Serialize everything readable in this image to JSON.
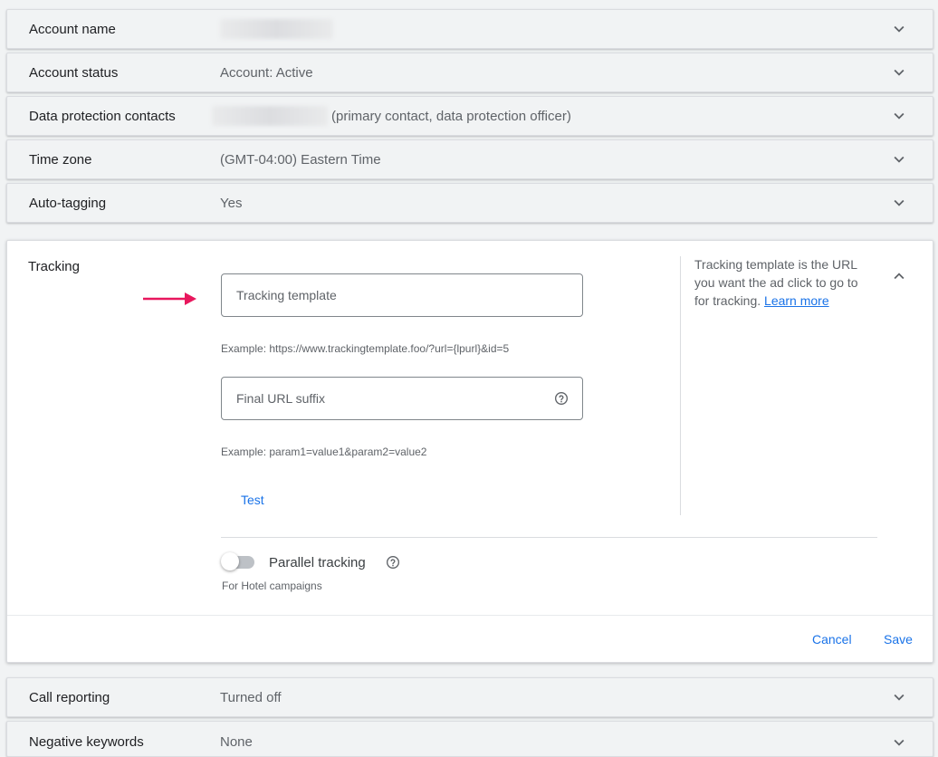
{
  "rows_top": [
    {
      "label": "Account name",
      "value": ""
    },
    {
      "label": "Account status",
      "value": "Account: Active"
    },
    {
      "label": "Data protection contacts",
      "value": "(primary contact, data protection officer)"
    },
    {
      "label": "Time zone",
      "value": "(GMT-04:00) Eastern Time"
    },
    {
      "label": "Auto-tagging",
      "value": "Yes"
    }
  ],
  "tracking": {
    "title": "Tracking",
    "template_placeholder": "Tracking template",
    "template_example": "Example: https://www.trackingtemplate.foo/?url={lpurl}&id=5",
    "suffix_placeholder": "Final URL suffix",
    "suffix_example": "Example: param1=value1&param2=value2",
    "test_label": "Test",
    "help_text": "Tracking template is the URL you want the ad click to go to for tracking.",
    "learn_more": "Learn more",
    "parallel_label": "Parallel tracking",
    "parallel_enabled": false,
    "parallel_note": "For Hotel campaigns",
    "cancel_label": "Cancel",
    "save_label": "Save"
  },
  "rows_bottom": [
    {
      "label": "Call reporting",
      "value": "Turned off"
    },
    {
      "label": "Negative keywords",
      "value": "None"
    }
  ],
  "icons": {
    "expand": "chevron-down-icon",
    "collapse": "chevron-up-icon",
    "help": "help-circle-icon",
    "pointer": "arrow-right-icon"
  },
  "colors": {
    "accent": "#1a73e8",
    "arrow": "#e8175d"
  }
}
